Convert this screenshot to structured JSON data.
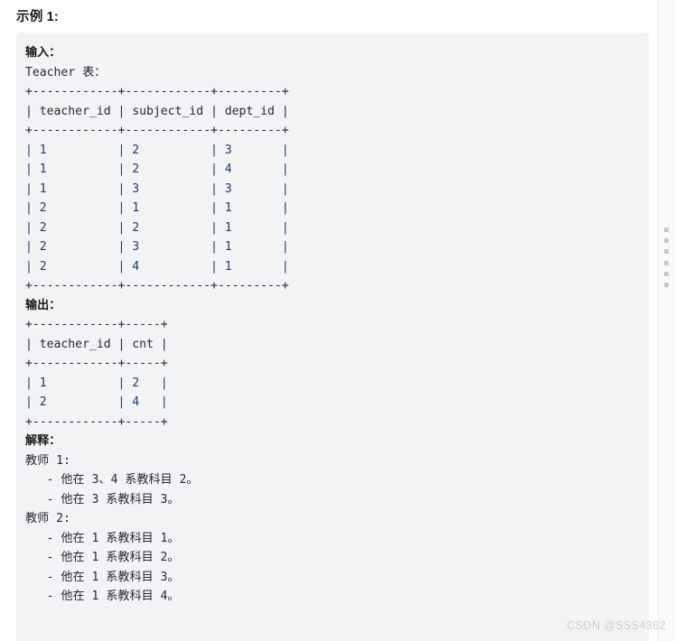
{
  "article": {
    "example_heading": "示例 1:",
    "watermark": "CSDN @SSS4362"
  },
  "code_block": {
    "input_label": "输入：",
    "input_table_caption": "Teacher 表：",
    "output_label": "输出：",
    "explanation_label": "解释：",
    "input_table": {
      "separator": "+------------+------------+---------+",
      "header": "| teacher_id | subject_id | dept_id |",
      "rows": [
        "| 1          | 2          | 3       |",
        "| 1          | 2          | 4       |",
        "| 1          | 3          | 3       |",
        "| 2          | 1          | 1       |",
        "| 2          | 2          | 1       |",
        "| 2          | 3          | 1       |",
        "| 2          | 4          | 1       |"
      ],
      "columns": [
        "teacher_id",
        "subject_id",
        "dept_id"
      ],
      "data": [
        [
          1,
          2,
          3
        ],
        [
          1,
          2,
          4
        ],
        [
          1,
          3,
          3
        ],
        [
          2,
          1,
          1
        ],
        [
          2,
          2,
          1
        ],
        [
          2,
          3,
          1
        ],
        [
          2,
          4,
          1
        ]
      ]
    },
    "output_table": {
      "separator": "+------------+-----+",
      "header": "| teacher_id | cnt |",
      "rows": [
        "| 1          | 2   |",
        "| 2          | 4   |"
      ],
      "columns": [
        "teacher_id",
        "cnt"
      ],
      "data": [
        [
          1,
          2
        ],
        [
          2,
          4
        ]
      ]
    },
    "explanation": {
      "teacher1_heading": "教师 1:",
      "teacher1_items": [
        "   - 他在 3、4 系教科目 2。",
        "   - 他在 3 系教科目 3。"
      ],
      "teacher2_heading": "教师 2:",
      "teacher2_items": [
        "   - 他在 1 系教科目 1。",
        "   - 他在 1 系教科目 2。",
        "   - 他在 1 系教科目 3。",
        "   - 他在 1 系教科目 4。"
      ]
    }
  },
  "colors": {
    "code_background": "#f2f3f5",
    "page_background": "#ffffff",
    "pipe": "#a0522d",
    "number": "#1b3d6d",
    "text": "#24292e",
    "watermark": "#cfcfcf"
  }
}
